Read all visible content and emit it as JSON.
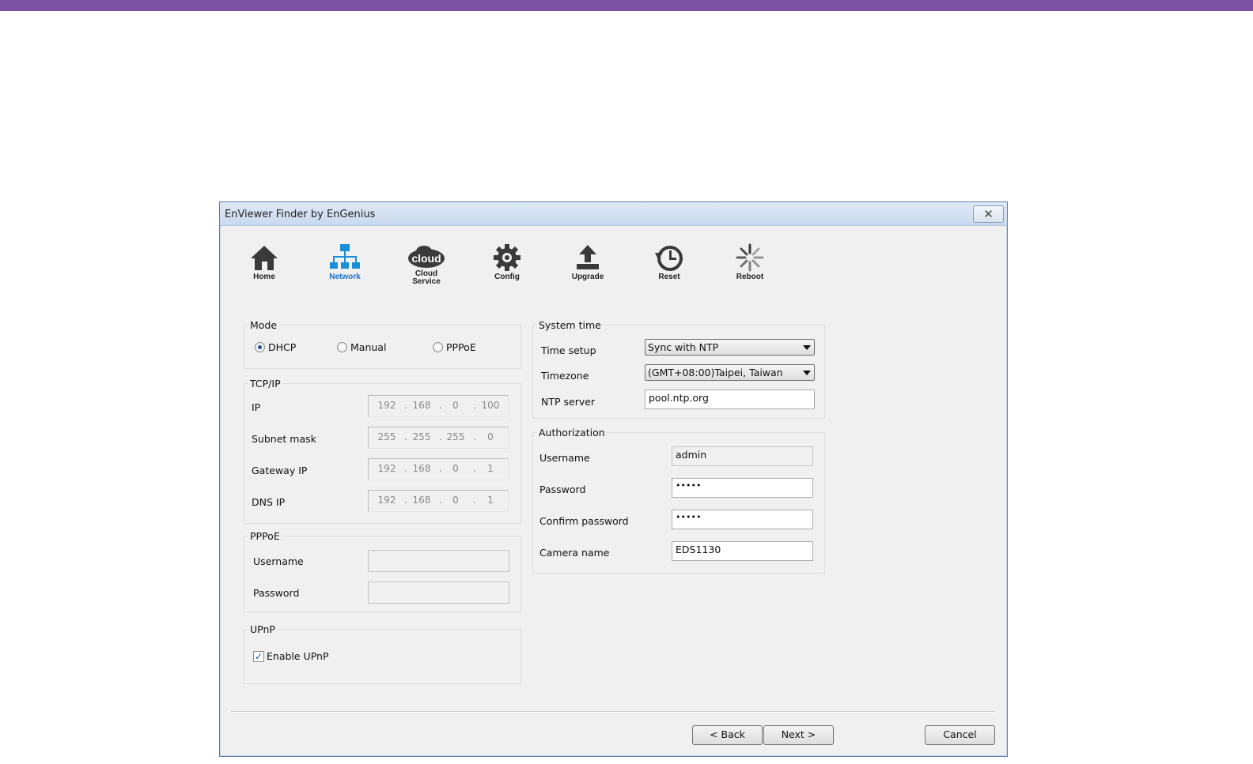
{
  "window": {
    "title": "EnViewer Finder by EnGenius"
  },
  "toolbar": [
    {
      "label": "Home",
      "icon": "home-icon"
    },
    {
      "label": "Network",
      "icon": "network-icon",
      "active": true
    },
    {
      "label": "Cloud\nService",
      "icon": "cloud-icon",
      "logo_text": "cloud"
    },
    {
      "label": "Config",
      "icon": "gear-icon"
    },
    {
      "label": "Upgrade",
      "icon": "upload-icon"
    },
    {
      "label": "Reset",
      "icon": "reset-clock-icon"
    },
    {
      "label": "Reboot",
      "icon": "spinner-icon"
    }
  ],
  "mode": {
    "legend": "Mode",
    "options": [
      "DHCP",
      "Manual",
      "PPPoE"
    ],
    "selected": "DHCP"
  },
  "tcpip": {
    "legend": "TCP/IP",
    "ip": {
      "label": "IP",
      "octets": [
        "192",
        "168",
        "0",
        "100"
      ]
    },
    "subnet": {
      "label": "Subnet mask",
      "octets": [
        "255",
        "255",
        "255",
        "0"
      ]
    },
    "gateway": {
      "label": "Gateway IP",
      "octets": [
        "192",
        "168",
        "0",
        "1"
      ]
    },
    "dns": {
      "label": "DNS IP",
      "octets": [
        "192",
        "168",
        "0",
        "1"
      ]
    }
  },
  "pppoe": {
    "legend": "PPPoE",
    "username_label": "Username",
    "username_value": "",
    "password_label": "Password",
    "password_value": ""
  },
  "upnp": {
    "legend": "UPnP",
    "checkbox_label": "Enable UPnP",
    "checked": true
  },
  "system_time": {
    "legend": "System time",
    "time_setup_label": "Time setup",
    "time_setup_value": "Sync with NTP",
    "timezone_label": "Timezone",
    "timezone_value": "(GMT+08:00)Taipei, Taiwan",
    "ntp_label": "NTP server",
    "ntp_value": "pool.ntp.org"
  },
  "authorization": {
    "legend": "Authorization",
    "username_label": "Username",
    "username_value": "admin",
    "password_label": "Password",
    "password_value": "•••••",
    "confirm_label": "Confirm password",
    "confirm_value": "•••••",
    "camera_label": "Camera name",
    "camera_value": "EDS1130"
  },
  "buttons": {
    "back": "< Back",
    "next": "Next >",
    "cancel": "Cancel"
  },
  "colors": {
    "top_bar": "#7b51a3",
    "active_tool": "#1b6fc6",
    "window_bg": "#f0f0f0"
  }
}
